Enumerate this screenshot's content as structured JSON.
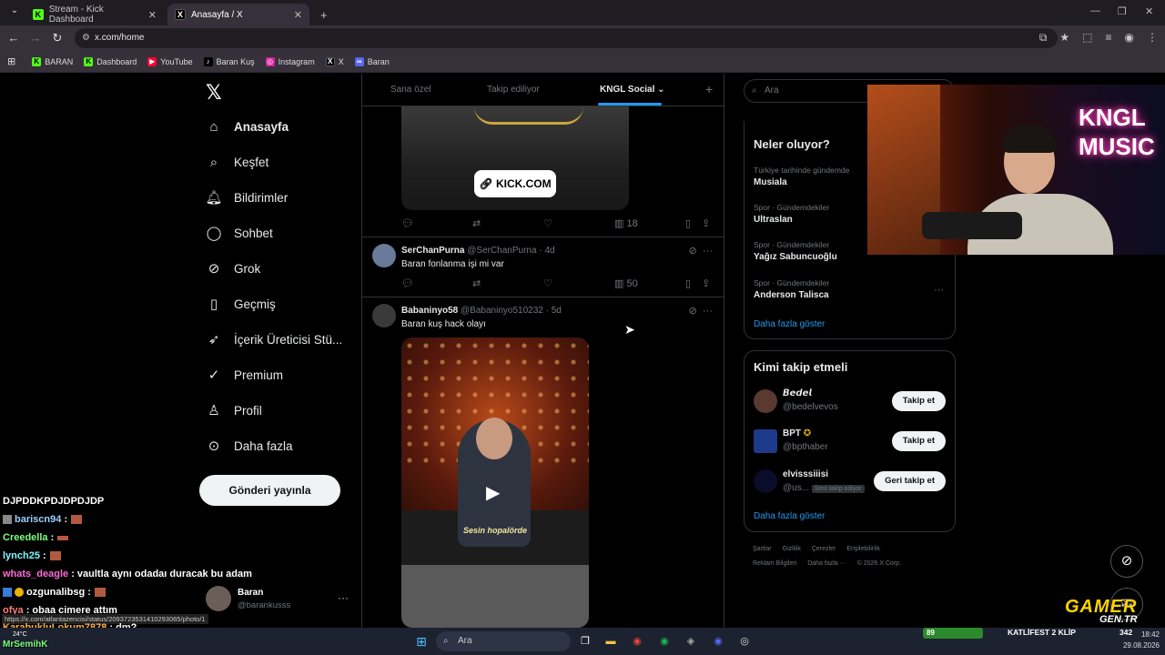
{
  "browser": {
    "tabs": [
      {
        "title": "Stream - Kick Dashboard",
        "icon": "kick-icon"
      },
      {
        "title": "Anasayfa / X",
        "icon": "x-icon"
      }
    ],
    "url": "x.com/home",
    "bookmarks": [
      "BARAN",
      "Dashboard",
      "YouTube",
      "Baran Kuş",
      "Instagram",
      "X",
      "Baran"
    ]
  },
  "sidebar": {
    "items": [
      {
        "label": "Anasayfa",
        "icon": "home-icon"
      },
      {
        "label": "Keşfet",
        "icon": "search-icon"
      },
      {
        "label": "Bildirimler",
        "icon": "bell-icon"
      },
      {
        "label": "Sohbet",
        "icon": "chat-icon"
      },
      {
        "label": "Grok",
        "icon": "grok-icon"
      },
      {
        "label": "Geçmiş",
        "icon": "bookmark-icon"
      },
      {
        "label": "İçerik Üreticisi Stü...",
        "icon": "rocket-icon"
      },
      {
        "label": "Premium",
        "icon": "verified-icon"
      },
      {
        "label": "Profil",
        "icon": "person-icon"
      },
      {
        "label": "Daha fazla",
        "icon": "more-circle-icon"
      }
    ],
    "post_button": "Gönderi yayınla",
    "account": {
      "name": "Baran",
      "handle": "@barankusss"
    }
  },
  "feed": {
    "tabs": [
      "Sana özel",
      "Takip ediliyor",
      "KNGL Social"
    ],
    "first_media": {
      "link_label": "KICK.COM",
      "views": "18"
    },
    "tweets": [
      {
        "name": "SerChanPurna",
        "handle": "@SerChanPurna · 4d",
        "text": "Baran fonlanma işi mi var",
        "views": "50"
      },
      {
        "name": "Babaninyo58",
        "handle": "@Babaninyo510232 · 5d",
        "text": "Baran kuş hack olayı",
        "video_caption": "Sesin hopalörde"
      }
    ]
  },
  "right": {
    "search_placeholder": "Ara",
    "trends_title": "Neler oluyor?",
    "trends": [
      {
        "category": "Türkiye tarihinde gündemde",
        "name": "Musiala"
      },
      {
        "category": "Spor · Gündemdekiler",
        "name": "Ultraslan"
      },
      {
        "category": "Spor · Gündemdekiler",
        "name": "Yağız Sabuncuoğlu"
      },
      {
        "category": "Spor · Gündemdekiler",
        "name": "Anderson Talisca"
      }
    ],
    "show_more": "Daha fazla göster",
    "who_to_follow_title": "Kimi takip etmeli",
    "who_to_follow": [
      {
        "name": "𝘽𝙚𝙙𝙚𝙡",
        "handle": "@bedelvevos",
        "button": "Takip et"
      },
      {
        "name": "BPT",
        "handle": "@bpthaber",
        "button": "Takip et"
      },
      {
        "name": "elvisssiiisi",
        "handle": "@us...",
        "tag": "Seni takip ediyor",
        "button": "Geri takip et"
      }
    ],
    "footer": [
      "Şartlar",
      "Gizlilik",
      "Çerezler",
      "Erişilebilirlik",
      "Reklam Bilgileri",
      "Daha fazla ···",
      "© 2026 X Corp."
    ]
  },
  "overlay": {
    "cam_sign": "KNGL MUSIC",
    "chat": [
      {
        "user": "DJPDDKPDJDPDJDP",
        "msg": "",
        "color": "#ffffff"
      },
      {
        "user": "bariscn94",
        "msg": ":",
        "color": "#9ad0ff"
      },
      {
        "user": "Creedella",
        "msg": ":",
        "color": "#7dff7d"
      },
      {
        "user": "lynch25",
        "msg": ":",
        "color": "#7df9ff"
      },
      {
        "user": "whats_deagle",
        "msg": ": vaultla aynı odadaı duracak bu adam",
        "color": "#ff6bd6"
      },
      {
        "user": "ozgunalibsg",
        "msg": ":",
        "color": "#ffffff"
      },
      {
        "user": "ofya",
        "msg": ": obaa cimere attım",
        "color": "#ff7f7f"
      },
      {
        "user": "KarabukluLokum7878",
        "msg": ": dm?",
        "color": "#ffb347"
      },
      {
        "user": "MrSemihK",
        "msg": "",
        "color": "#7dff7d"
      }
    ],
    "status_url": "https://x.com/atlantazencisi/status/2093723531410293065/photo/1",
    "brand": "GAMER",
    "brand_sub": "GEN.TR",
    "game_hud": {
      "hp": "89",
      "clip": "KATLİFEST 2 KLİP",
      "number": "342"
    }
  },
  "taskbar": {
    "search": "Ara",
    "weather": "24°C",
    "time": "18:42",
    "date": "29.08.2026"
  }
}
